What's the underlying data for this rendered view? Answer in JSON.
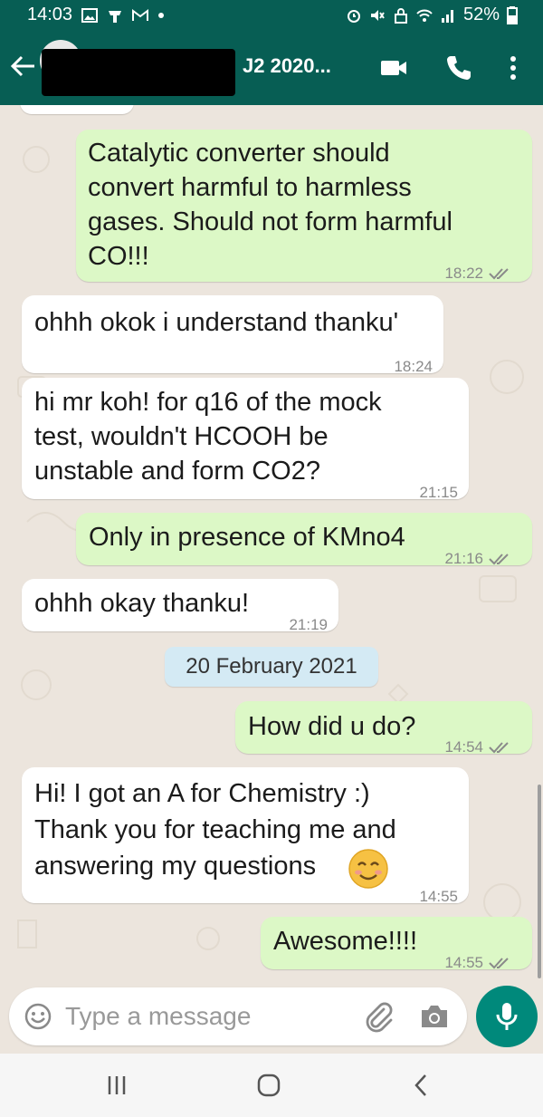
{
  "status_bar": {
    "time": "14:03",
    "battery": "52%"
  },
  "header": {
    "title": "J2 2020..."
  },
  "messages": [
    {
      "side": "out",
      "text": "Catalytic converter should\nconvert harmful to harmless\ngases. Should not form harmful\nCO!!!",
      "time": "18:22",
      "ticks": "read"
    },
    {
      "side": "in",
      "text": "ohhh okok i understand thanku'",
      "time": "18:24"
    },
    {
      "side": "in",
      "text": "hi mr koh! for q16 of the mock\ntest, wouldn't HCOOH be\nunstable and form CO2?",
      "time": "21:15"
    },
    {
      "side": "out",
      "text": "Only in presence of KMno4",
      "time": "21:16",
      "ticks": "read"
    },
    {
      "side": "in",
      "text": "ohhh okay thanku!",
      "time": "21:19"
    },
    {
      "side": "out",
      "text": "How did u do?",
      "time": "14:54",
      "ticks": "read"
    },
    {
      "side": "in",
      "text": "Hi! I got an A for Chemistry :)\nThank you for teaching me and\nanswering my questions",
      "time": "14:55",
      "emoji": "smiling-face-icon"
    },
    {
      "side": "out",
      "text": "Awesome!!!!",
      "time": "14:55",
      "ticks": "read"
    }
  ],
  "date_divider": "20 February 2021",
  "composer": {
    "placeholder": "Type a message"
  },
  "colors": {
    "header": "#075e54",
    "outgoing_bubble": "#dcf8c6",
    "incoming_bubble": "#ffffff",
    "chat_background": "#ece5dd",
    "read_ticks": "#8a8a8a",
    "mic_button": "#00897b"
  },
  "icons": [
    "back-arrow-icon",
    "video-call-icon",
    "voice-call-icon",
    "more-options-icon",
    "emoji-icon",
    "attach-icon",
    "camera-icon",
    "mic-icon"
  ]
}
